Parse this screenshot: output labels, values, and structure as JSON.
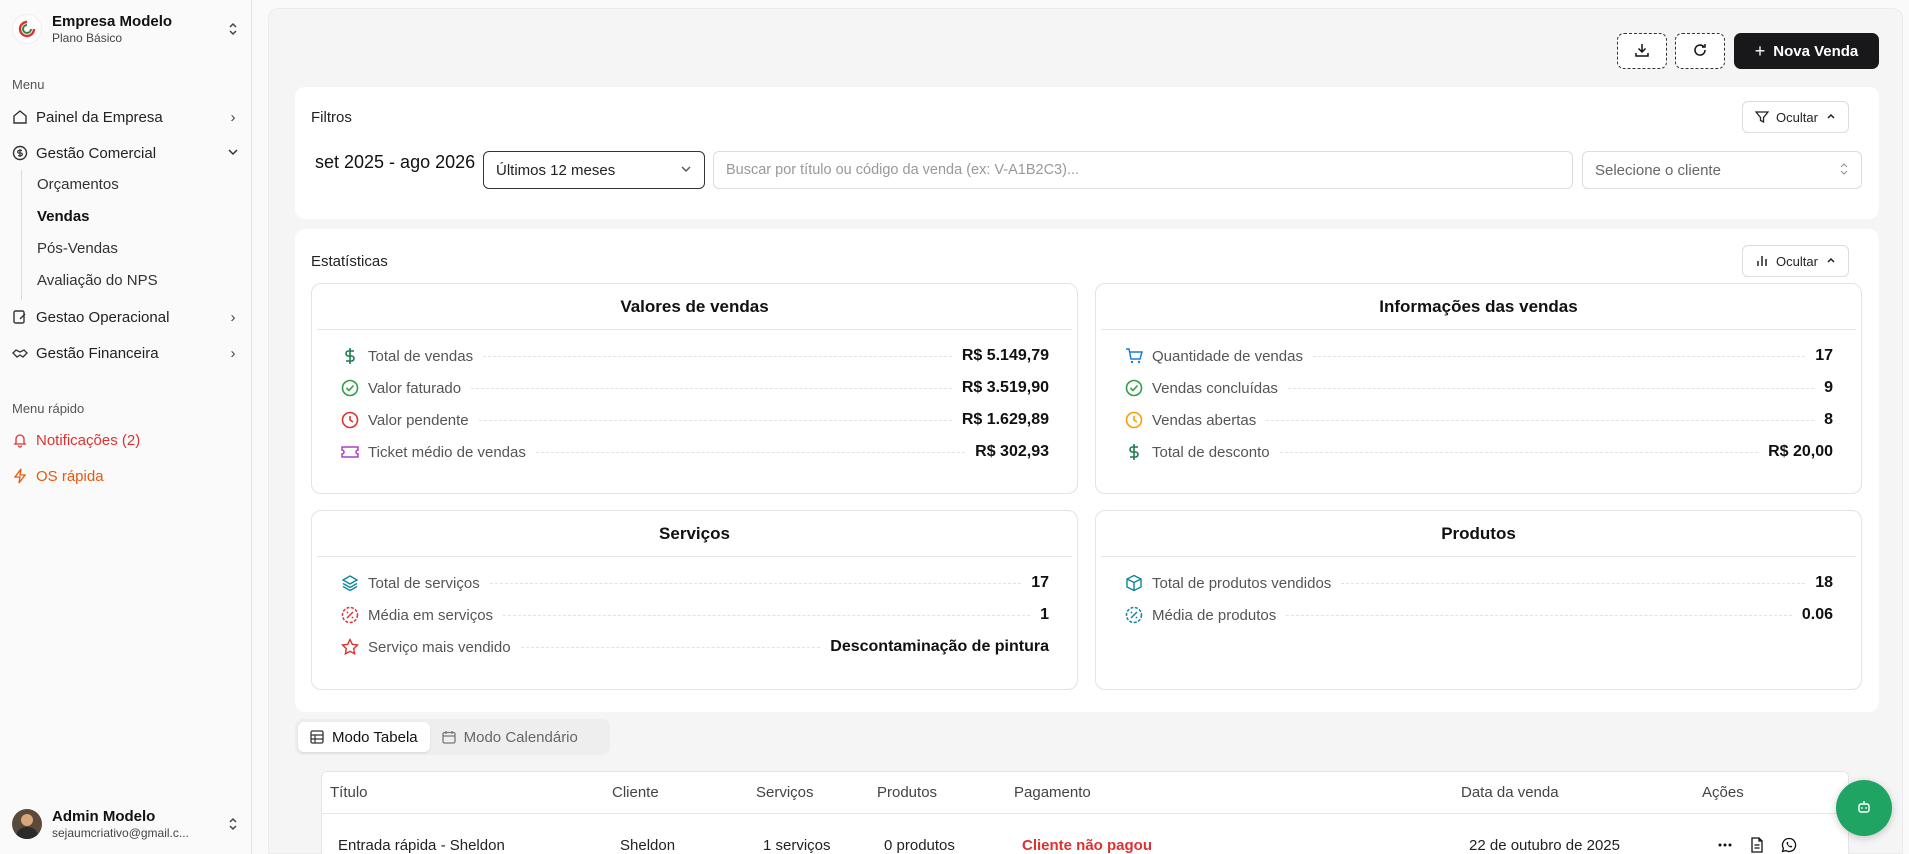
{
  "company": {
    "name": "Empresa Modelo",
    "plan": "Plano Básico"
  },
  "sidebar": {
    "menu_label": "Menu",
    "items": [
      {
        "label": "Painel da Empresa"
      },
      {
        "label": "Gestão Comercial"
      },
      {
        "label": "Gestao Operacional"
      },
      {
        "label": "Gestão Financeira"
      }
    ],
    "sub_items": [
      "Orçamentos",
      "Vendas",
      "Pós-Vendas",
      "Avaliação do NPS"
    ],
    "quick_label": "Menu rápido",
    "quick": {
      "notifications": "Notificações (2)",
      "os": "OS rápida"
    }
  },
  "user": {
    "name": "Admin Modelo",
    "email": "sejaumcriativo@gmail.c..."
  },
  "toolbar": {
    "new_sale": "Nova Venda"
  },
  "filters": {
    "title": "Filtros",
    "hide_label": "Ocultar",
    "period": "set 2025 - ago 2026",
    "period_select": "Últimos 12 meses",
    "search_placeholder": "Buscar por título ou código da venda (ex: V-A1B2C3)...",
    "client_placeholder": "Selecione o cliente"
  },
  "stats": {
    "title": "Estatísticas",
    "hide_label": "Ocultar",
    "sales_values": {
      "title": "Valores de vendas",
      "rows": [
        {
          "label": "Total de vendas",
          "value": "R$ 5.149,79"
        },
        {
          "label": "Valor faturado",
          "value": "R$ 3.519,90"
        },
        {
          "label": "Valor pendente",
          "value": "R$ 1.629,89"
        },
        {
          "label": "Ticket médio de vendas",
          "value": "R$ 302,93"
        }
      ]
    },
    "sales_info": {
      "title": "Informações das vendas",
      "rows": [
        {
          "label": "Quantidade de vendas",
          "value": "17"
        },
        {
          "label": "Vendas concluídas",
          "value": "9"
        },
        {
          "label": "Vendas abertas",
          "value": "8"
        },
        {
          "label": "Total de desconto",
          "value": "R$ 20,00"
        }
      ]
    },
    "services": {
      "title": "Serviços",
      "rows": [
        {
          "label": "Total de serviços",
          "value": "17"
        },
        {
          "label": "Média em serviços",
          "value": "1"
        },
        {
          "label": "Serviço mais vendido",
          "value": "Descontaminação de pintura"
        }
      ]
    },
    "products": {
      "title": "Produtos",
      "rows": [
        {
          "label": "Total de produtos vendidos",
          "value": "18"
        },
        {
          "label": "Média de produtos",
          "value": "0.06"
        }
      ]
    }
  },
  "view_tabs": {
    "table": "Modo Tabela",
    "calendar": "Modo Calendário"
  },
  "table": {
    "headers": [
      "Título",
      "Cliente",
      "Serviços",
      "Produtos",
      "Pagamento",
      "Data da venda",
      "Ações"
    ],
    "rows": [
      {
        "title": "Entrada rápida - Sheldon",
        "client": "Sheldon",
        "services": "1 serviços",
        "products": "0 produtos",
        "payment": "Cliente não pagou",
        "date": "22 de outubro de 2025"
      }
    ]
  }
}
